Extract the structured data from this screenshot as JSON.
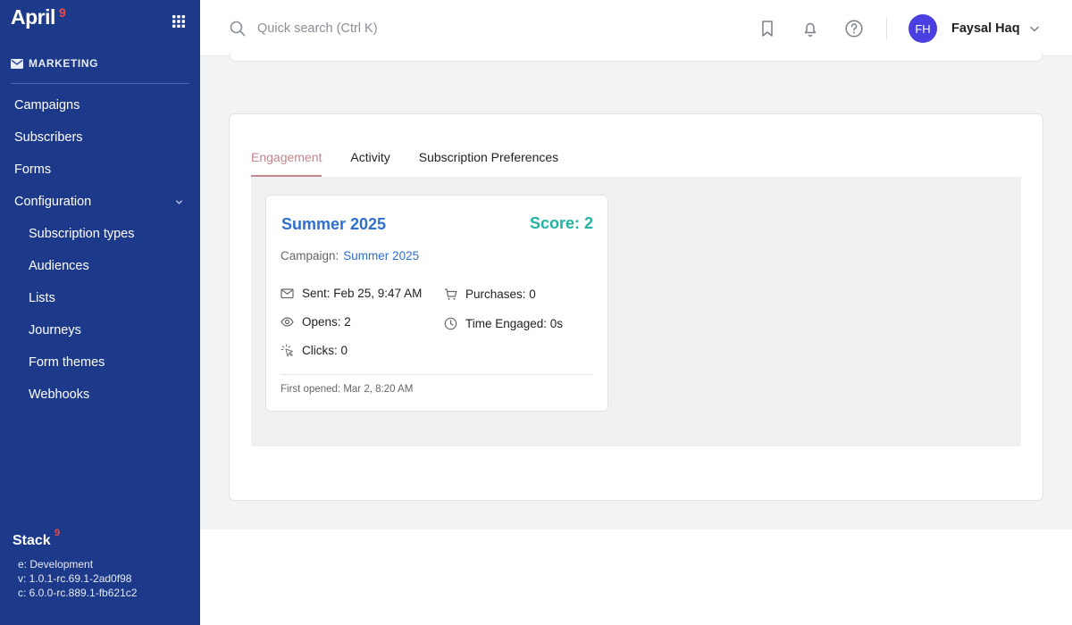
{
  "brand": {
    "name": "April",
    "badge": "9"
  },
  "sidebar": {
    "section": "MARKETING",
    "items": [
      {
        "label": "Campaigns"
      },
      {
        "label": "Subscribers"
      },
      {
        "label": "Forms"
      },
      {
        "label": "Configuration"
      }
    ],
    "sub_items": [
      {
        "label": "Subscription types"
      },
      {
        "label": "Audiences"
      },
      {
        "label": "Lists"
      },
      {
        "label": "Journeys"
      },
      {
        "label": "Form themes"
      },
      {
        "label": "Webhooks"
      }
    ],
    "footer": {
      "brand": "Stack",
      "badge": "9",
      "env": "e: Development",
      "version": "v: 1.0.1-rc.69.1-2ad0f98",
      "core": "c: 6.0.0-rc.889.1-fb621c2"
    }
  },
  "header": {
    "search_placeholder": "Quick search (Ctrl K)",
    "user": {
      "initials": "FH",
      "name": "Faysal Haq"
    }
  },
  "tabs": [
    {
      "label": "Engagement",
      "active": true
    },
    {
      "label": "Activity",
      "active": false
    },
    {
      "label": "Subscription Preferences",
      "active": false
    }
  ],
  "engagement_card": {
    "title": "Summer 2025",
    "score": "Score: 2",
    "campaign_label": "Campaign:",
    "campaign_name": "Summer 2025",
    "sent": "Sent: Feb 25, 9:47 AM",
    "opens": "Opens: 2",
    "clicks": "Clicks: 0",
    "purchases": "Purchases: 0",
    "time_engaged": "Time Engaged: 0s",
    "first_opened": "First opened: Mar 2, 8:20 AM"
  },
  "colors": {
    "sidebar_bg": "#1d3a8a",
    "accent_tab": "#c2868c",
    "link": "#2f6fd1",
    "score": "#22b3a0",
    "avatar": "#4a3fe0"
  }
}
